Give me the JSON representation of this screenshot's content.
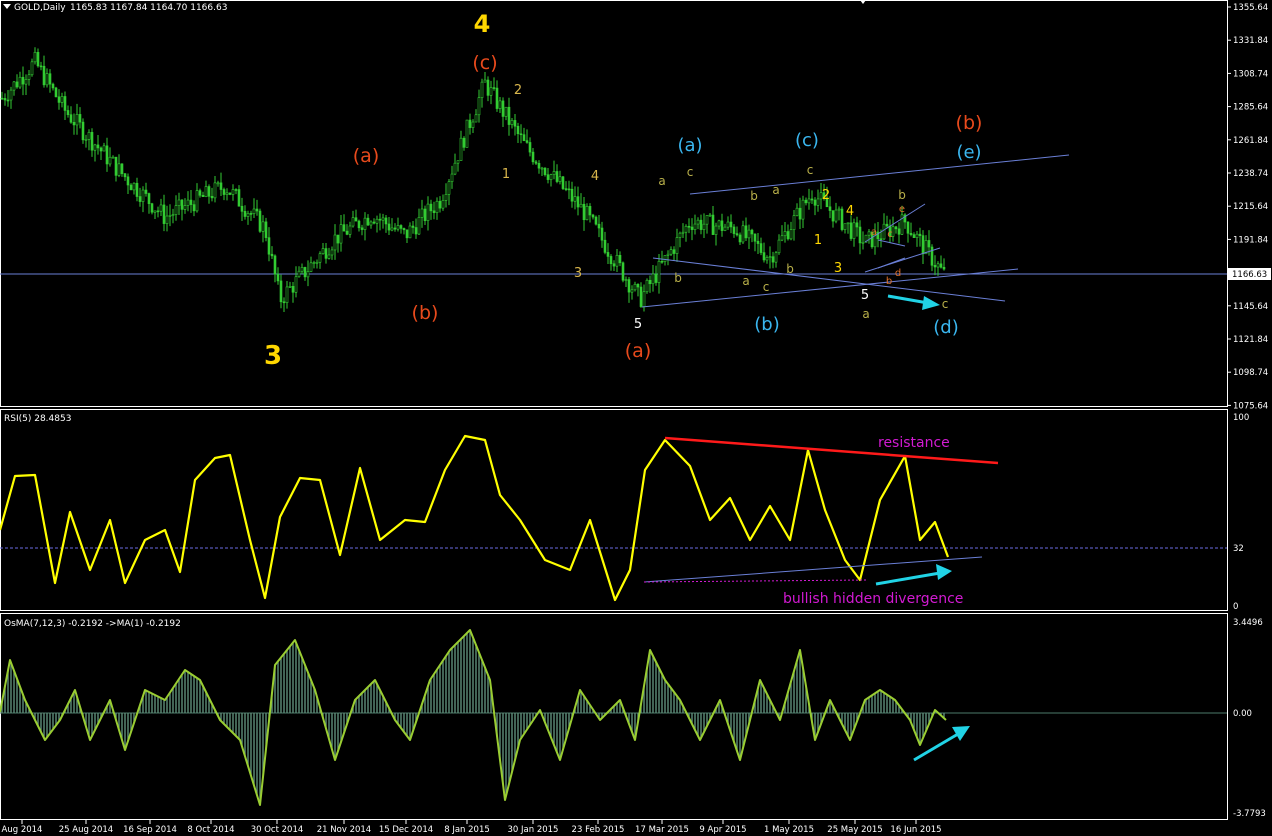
{
  "colors": {
    "background": "#000000",
    "candle": "#33cc33",
    "rsi_line": "#ffff00",
    "osma_line": "#9acd32",
    "osma_bar": "#5f8f7a",
    "grid_line": "#6a7fd6",
    "wave_yellow": "#ffd700",
    "wave_orange": "#e84a1c",
    "wave_blue": "#3ab6ef",
    "wave_small": "#d9b64c",
    "resistance": "#ff1a1a",
    "divergence_text": "#d21ad2",
    "arrow": "#21d3e6",
    "axis_text": "#ffffff"
  },
  "header": {
    "symbol": "GOLD,Daily",
    "ohlc": "1165.83 1167.84 1164.70 1166.63"
  },
  "price_panel": {
    "y_ticks": [
      "1355.64",
      "1331.84",
      "1308.74",
      "1285.64",
      "1261.84",
      "1238.74",
      "1215.64",
      "1191.84",
      "1168.74",
      "1145.64",
      "1121.84",
      "1098.74",
      "1075.64"
    ],
    "current_price": "1166.63"
  },
  "rsi_panel": {
    "label": "RSI(5) 28.4853",
    "y_ticks": [
      "100",
      "32",
      "0"
    ],
    "annotation_resistance": "resistance",
    "annotation_divergence": "bullish hidden divergence"
  },
  "osma_panel": {
    "label": "OsMA(7,12,3) -0.2192  ->MA(1) -0.2192",
    "y_ticks": [
      "3.4496",
      "0.00",
      "-3.7793"
    ]
  },
  "x_ticks": [
    "Aug 2014",
    "25 Aug 2014",
    "16 Sep 2014",
    "8 Oct 2014",
    "30 Oct 2014",
    "21 Nov 2014",
    "15 Dec 2014",
    "8 Jan 2015",
    "30 Jan 2015",
    "23 Feb 2015",
    "17 Mar 2015",
    "9 Apr 2015",
    "1 May 2015",
    "25 May 2015",
    "16 Jun 2015"
  ],
  "chart_data": [
    {
      "type": "candlestick",
      "title": "GOLD,Daily",
      "ylim": [
        1075.64,
        1355.64
      ],
      "price_anchors": {
        "dates": [
          "Aug 2014",
          "mid Aug 2014",
          "25 Aug 2014",
          "16 Sep 2014",
          "early Oct 2014",
          "8 Oct 2014",
          "late Oct 2014",
          "5 Nov 2014",
          "21 Nov 2014",
          "28 Nov 2014",
          "15 Dec 2014",
          "8 Jan 2015",
          "22 Jan 2015",
          "30 Jan 2015",
          "23 Feb 2015",
          "17 Mar 2015",
          "26 Mar 2015",
          "9 Apr 2015",
          "1 May 2015",
          "15 May 2015",
          "25 May 2015",
          "16 Jun 2015",
          "end Jun 2015"
        ],
        "closes": [
          1290,
          1317,
          1283,
          1240,
          1208,
          1230,
          1200,
          1150,
          1193,
          1210,
          1195,
          1220,
          1302,
          1258,
          1211,
          1150,
          1205,
          1200,
          1180,
          1225,
          1190,
          1205,
          1166.63
        ]
      },
      "wave_labels": [
        "4",
        "(c)",
        "2",
        "1",
        "4",
        "3",
        "5",
        "(a)",
        "(b)",
        "3",
        "(a)",
        "a",
        "c",
        "(a)",
        "b",
        "a",
        "c",
        "(b)",
        "b",
        "a",
        "b",
        "(c)",
        "c",
        "2",
        "4",
        "1",
        "3",
        "a",
        "c",
        "b",
        "e",
        "d",
        "5",
        "a",
        "c",
        "(b)",
        "(e)",
        "(d)"
      ]
    },
    {
      "type": "line",
      "title": "RSI(5) 28.4853",
      "ylim": [
        0,
        100
      ],
      "levels": [
        32
      ],
      "annotations": [
        "resistance",
        "bullish hidden divergence"
      ]
    },
    {
      "type": "bar",
      "title": "OsMA(7,12,3) -0.2192  ->MA(1) -0.2192",
      "ylim": [
        -3.7793,
        3.4496
      ]
    }
  ]
}
